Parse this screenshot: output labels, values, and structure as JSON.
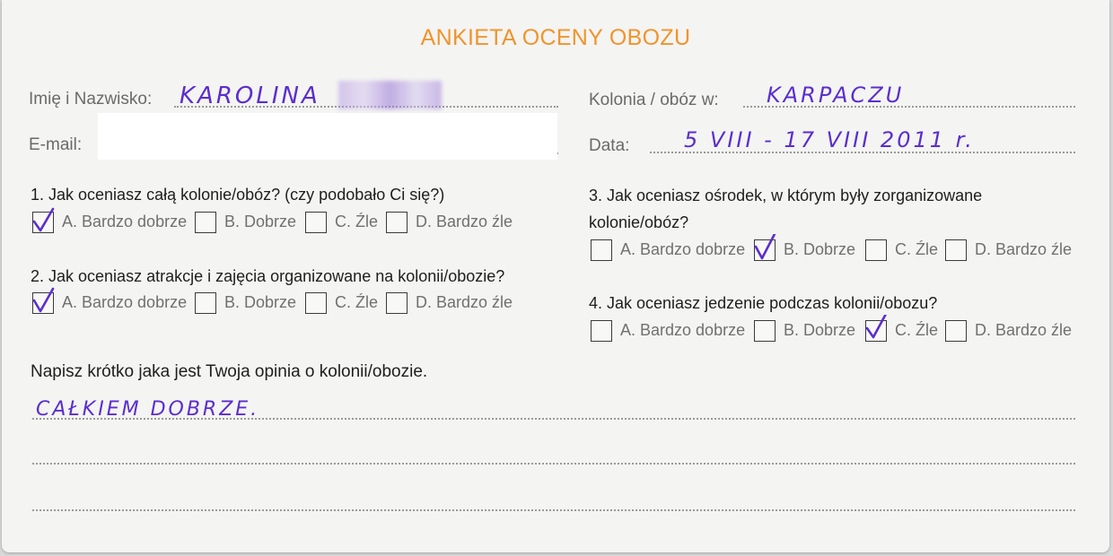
{
  "form": {
    "title": "ANKIETA OCENY OBOZU",
    "fields": {
      "name_label": "Imię i Nazwisko:",
      "name_value": "KAROLINA",
      "email_label": "E-mail:",
      "camp_label": "Kolonia / obóz w:",
      "camp_value": "KARPACZU",
      "date_label": "Data:",
      "date_value": "5 VIII - 17 VIII  2011 r."
    },
    "questions": [
      {
        "text": "1. Jak oceniasz całą kolonie/obóz? (czy podobało Ci się?)",
        "options": [
          "A. Bardzo dobrze",
          "B. Dobrze",
          "C. Źle",
          "D. Bardzo źle"
        ],
        "checked": 0
      },
      {
        "text": "2.  Jak oceniasz atrakcje i zajęcia organizowane na kolonii/obozie?",
        "options": [
          "A. Bardzo dobrze",
          "B. Dobrze",
          "C. Źle",
          "D. Bardzo źle"
        ],
        "checked": 0
      },
      {
        "text_line1": "3. Jak oceniasz ośrodek, w którym były zorganizowane",
        "text_line2": "kolonie/obóz?",
        "options": [
          "A. Bardzo dobrze",
          "B. Dobrze",
          "C. Źle",
          "D. Bardzo źle"
        ],
        "checked": 1
      },
      {
        "text": "4.  Jak oceniasz jedzenie podczas kolonii/obozu?",
        "options": [
          "A. Bardzo dobrze",
          "B. Dobrze",
          "C. Źle",
          "D. Bardzo źle"
        ],
        "checked": 2
      }
    ],
    "opinion": {
      "prompt": "Napisz krótko jaka jest Twoja opinia o kolonii/obozie.",
      "answer": "CAŁKIEM DOBRZE."
    }
  }
}
